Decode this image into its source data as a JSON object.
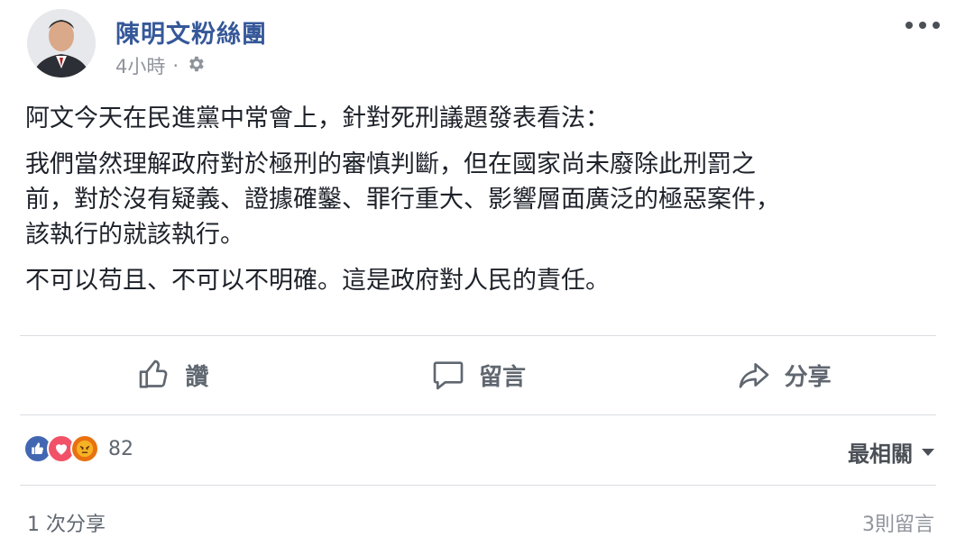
{
  "post": {
    "page_name": "陳明文粉絲團",
    "time": "4小時",
    "separator": "·",
    "paragraphs": [
      "阿文今天在民進黨中常會上，針對死刑議題發表看法：",
      "我們當然理解政府對於極刑的審慎判斷，但在國家尚未廢除此刑罰之\n前，對於沒有疑義、證據確鑿、罪行重大、影響層面廣泛的極惡案件，\n該執行的就該執行。",
      "不可以苟且、不可以不明確。這是政府對人民的責任。"
    ]
  },
  "actions": {
    "like_label": "讚",
    "comment_label": "留言",
    "share_label": "分享"
  },
  "reactions": {
    "count": "82",
    "types": [
      "like-icon",
      "love-icon",
      "angry-icon"
    ]
  },
  "sort": {
    "label": "最相關"
  },
  "footer": {
    "shares": "1 次分享",
    "comments": "3則留言"
  },
  "colors": {
    "link_blue": "#365899",
    "like_blue": "#4267b2",
    "love_red": "#f25268",
    "angry_orange": "#e9710f",
    "muted": "#90949c"
  }
}
